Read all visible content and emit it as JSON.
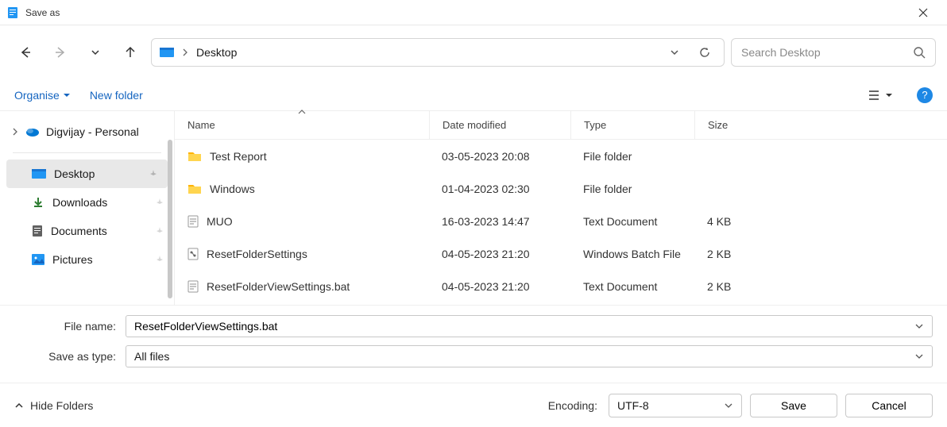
{
  "window": {
    "title": "Save as"
  },
  "breadcrumb": {
    "location": "Desktop"
  },
  "search": {
    "placeholder": "Search Desktop"
  },
  "toolbar": {
    "organise": "Organise",
    "new_folder": "New folder"
  },
  "sidebar": {
    "top_item": "Digvijay - Personal",
    "items": [
      {
        "label": "Desktop"
      },
      {
        "label": "Downloads"
      },
      {
        "label": "Documents"
      },
      {
        "label": "Pictures"
      }
    ]
  },
  "columns": {
    "name": "Name",
    "date": "Date modified",
    "type": "Type",
    "size": "Size"
  },
  "files": [
    {
      "icon": "folder",
      "name": "Test Report",
      "date": "03-05-2023 20:08",
      "type": "File folder",
      "size": ""
    },
    {
      "icon": "folder",
      "name": "Windows",
      "date": "01-04-2023 02:30",
      "type": "File folder",
      "size": ""
    },
    {
      "icon": "text",
      "name": "MUO",
      "date": "16-03-2023 14:47",
      "type": "Text Document",
      "size": "4 KB"
    },
    {
      "icon": "batch",
      "name": "ResetFolderSettings",
      "date": "04-05-2023 21:20",
      "type": "Windows Batch File",
      "size": "2 KB"
    },
    {
      "icon": "text",
      "name": "ResetFolderViewSettings.bat",
      "date": "04-05-2023 21:20",
      "type": "Text Document",
      "size": "2 KB"
    }
  ],
  "form": {
    "filename_label": "File name:",
    "filename_value": "ResetFolderViewSettings.bat",
    "type_label": "Save as type:",
    "type_value": "All files"
  },
  "footer": {
    "hide_folders": "Hide Folders",
    "encoding_label": "Encoding:",
    "encoding_value": "UTF-8",
    "save": "Save",
    "cancel": "Cancel"
  }
}
